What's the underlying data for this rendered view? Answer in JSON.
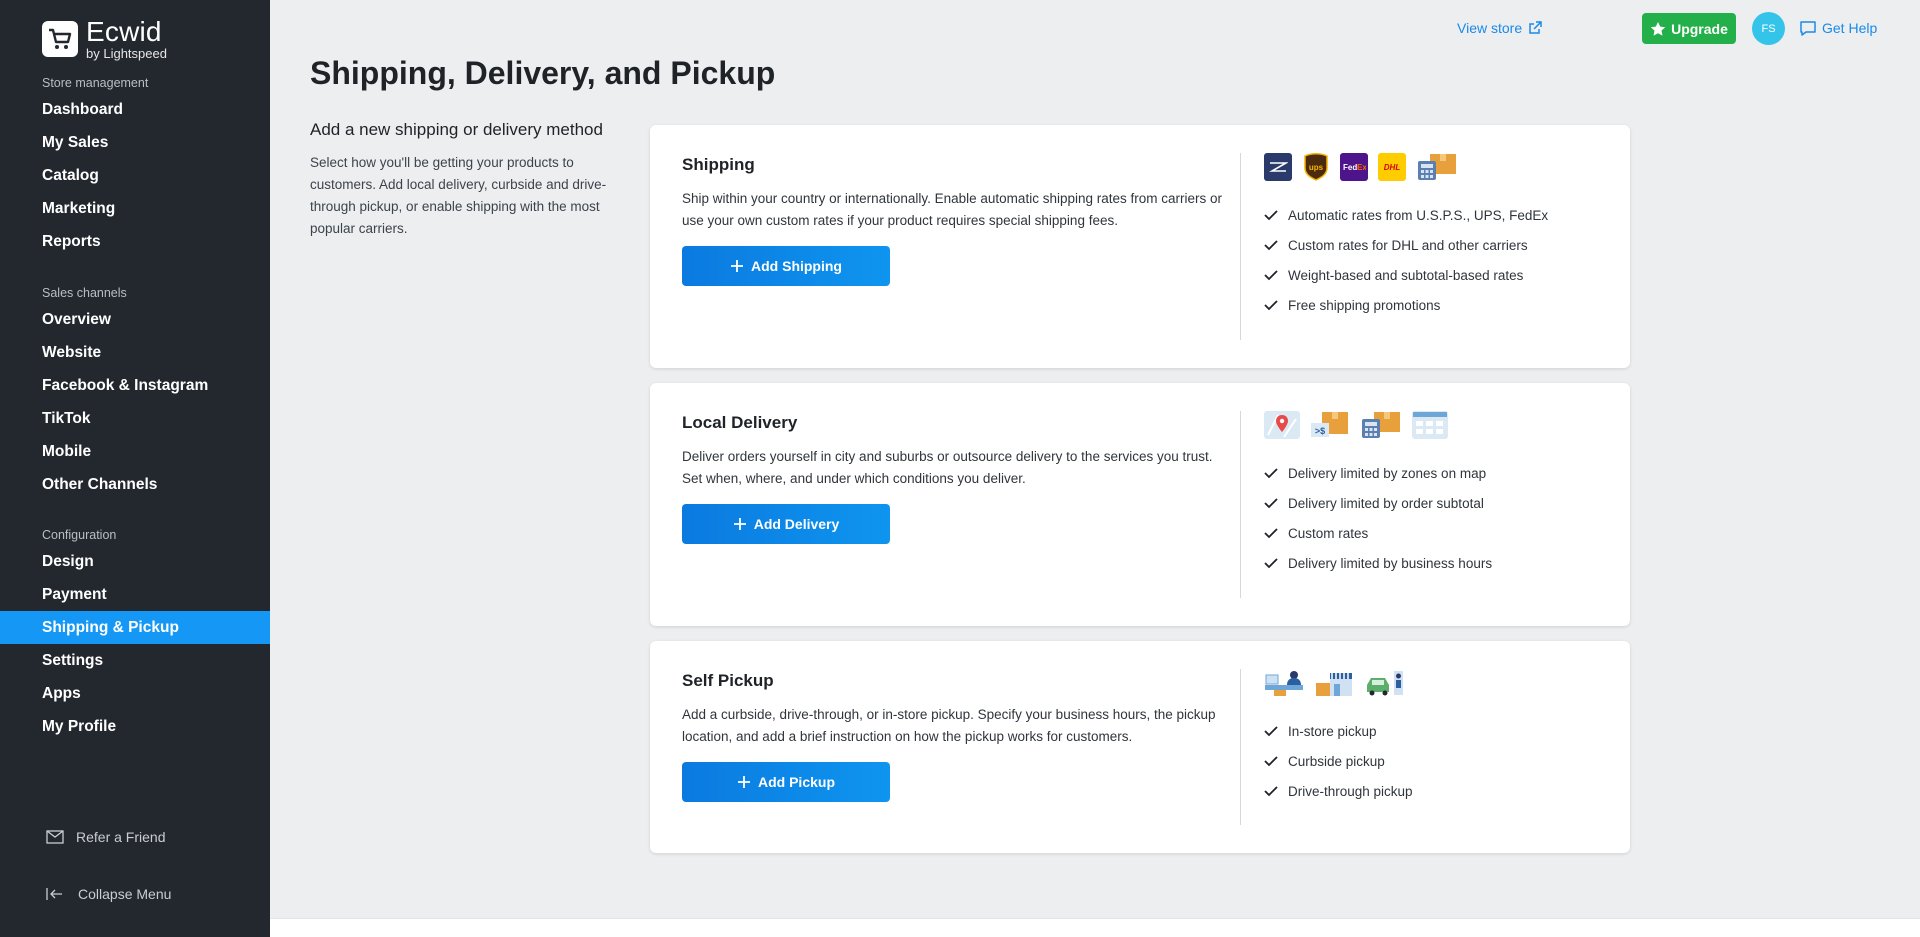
{
  "brand": {
    "name": "Ecwid",
    "sub": "by Lightspeed"
  },
  "sidebar": {
    "sections": [
      {
        "heading": "Store management",
        "items": [
          "Dashboard",
          "My Sales",
          "Catalog",
          "Marketing",
          "Reports"
        ]
      },
      {
        "heading": "Sales channels",
        "items": [
          "Overview",
          "Website",
          "Facebook & Instagram",
          "TikTok",
          "Mobile",
          "Other Channels"
        ]
      },
      {
        "heading": "Configuration",
        "items": [
          "Design",
          "Payment",
          "Shipping & Pickup",
          "Settings",
          "Apps",
          "My Profile"
        ]
      }
    ],
    "active_item": "Shipping & Pickup",
    "refer": "Refer a Friend",
    "collapse": "Collapse Menu"
  },
  "topbar": {
    "view_store": "View store",
    "upgrade": "Upgrade",
    "avatar_initials": "FS",
    "get_help": "Get Help"
  },
  "page": {
    "title": "Shipping, Delivery, and Pickup",
    "intro_title": "Add a new shipping or delivery method",
    "intro_desc": "Select how you'll be getting your products to customers. Add local delivery, curbside and drive-through pickup, or enable shipping with the most popular carriers."
  },
  "cards": [
    {
      "title": "Shipping",
      "desc": "Ship within your country or internationally. Enable automatic shipping rates from carriers or use your own custom rates if your product requires special shipping fees.",
      "button": "Add Shipping",
      "icons": [
        "usps-icon",
        "ups-icon",
        "fedex-icon",
        "dhl-icon",
        "calculator-box-icon"
      ],
      "features": [
        "Automatic rates from U.S.P.S., UPS, FedEx",
        "Custom rates for DHL and other carriers",
        "Weight-based and subtotal-based rates",
        "Free shipping promotions"
      ]
    },
    {
      "title": "Local Delivery",
      "desc": "Deliver orders yourself in city and suburbs or outsource delivery to the services you trust. Set when, where, and under which conditions you deliver.",
      "button": "Add Delivery",
      "icons": [
        "map-pin-icon",
        "subtotal-box-icon",
        "calculator-box-icon",
        "calendar-icon"
      ],
      "features": [
        "Delivery limited by zones on map",
        "Delivery limited by order subtotal",
        "Custom rates",
        "Delivery limited by business hours"
      ]
    },
    {
      "title": "Self Pickup",
      "desc": "Add a curbside, drive-through, or in-store pickup. Specify your business hours, the pickup location, and add a brief instruction on how the pickup works for customers.",
      "button": "Add Pickup",
      "icons": [
        "store-clerk-icon",
        "storefront-icon",
        "car-pickup-icon"
      ],
      "features": [
        "In-store pickup",
        "Curbside pickup",
        "Drive-through pickup"
      ]
    }
  ]
}
